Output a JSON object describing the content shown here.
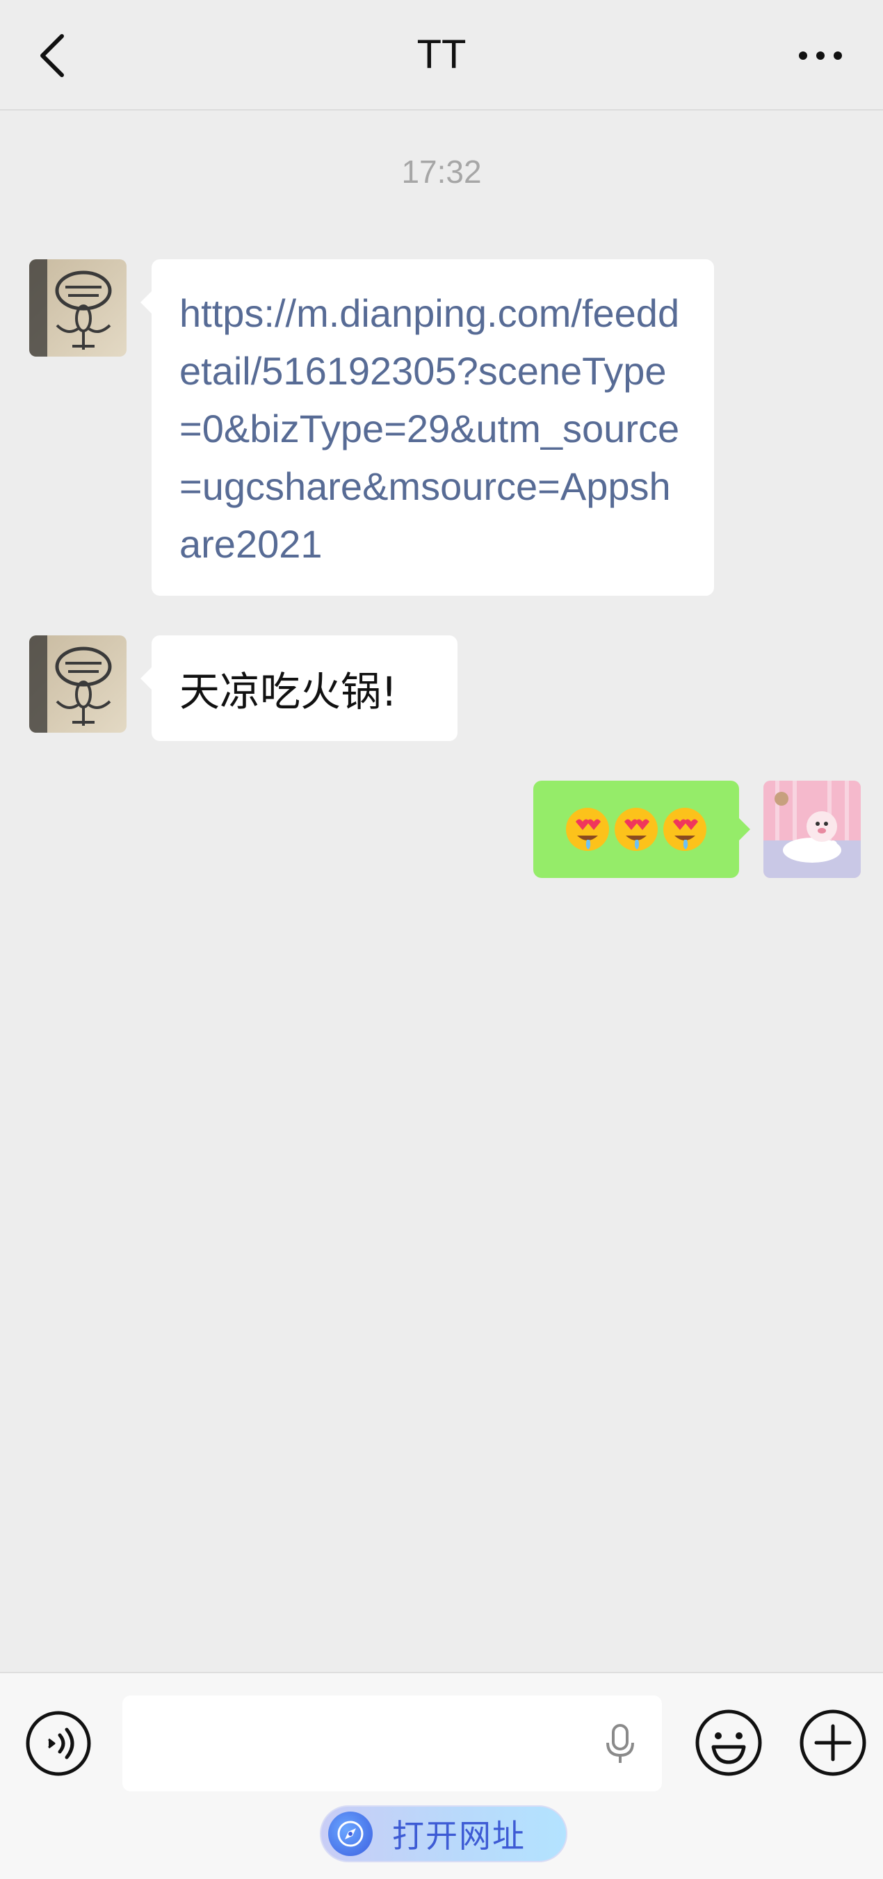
{
  "header": {
    "title": "TT",
    "back_icon": "chevron-left-icon",
    "more_icon": "more-dots-icon"
  },
  "timestamp": "17:32",
  "messages": [
    {
      "side": "left",
      "type": "link",
      "text": "https://m.dianping.com/feeddetail/516192305?sceneType=0&bizType=29&utm_source=ugcshare&msource=Appshare2021"
    },
    {
      "side": "left",
      "type": "text",
      "text": "天凉吃火锅!"
    },
    {
      "side": "right",
      "type": "emoji",
      "text": "🤤😍🤤"
    }
  ],
  "input_bar": {
    "voice_icon": "voice-mode-icon",
    "mic_icon": "microphone-icon",
    "emoji_icon": "smiley-icon",
    "plus_icon": "plus-icon",
    "input_value": ""
  },
  "open_url": {
    "label": "打开网址",
    "icon": "browser-icon"
  },
  "colors": {
    "background": "#ededed",
    "bubble_self": "#95ec69",
    "bubble_other": "#ffffff",
    "link": "#576b95"
  }
}
